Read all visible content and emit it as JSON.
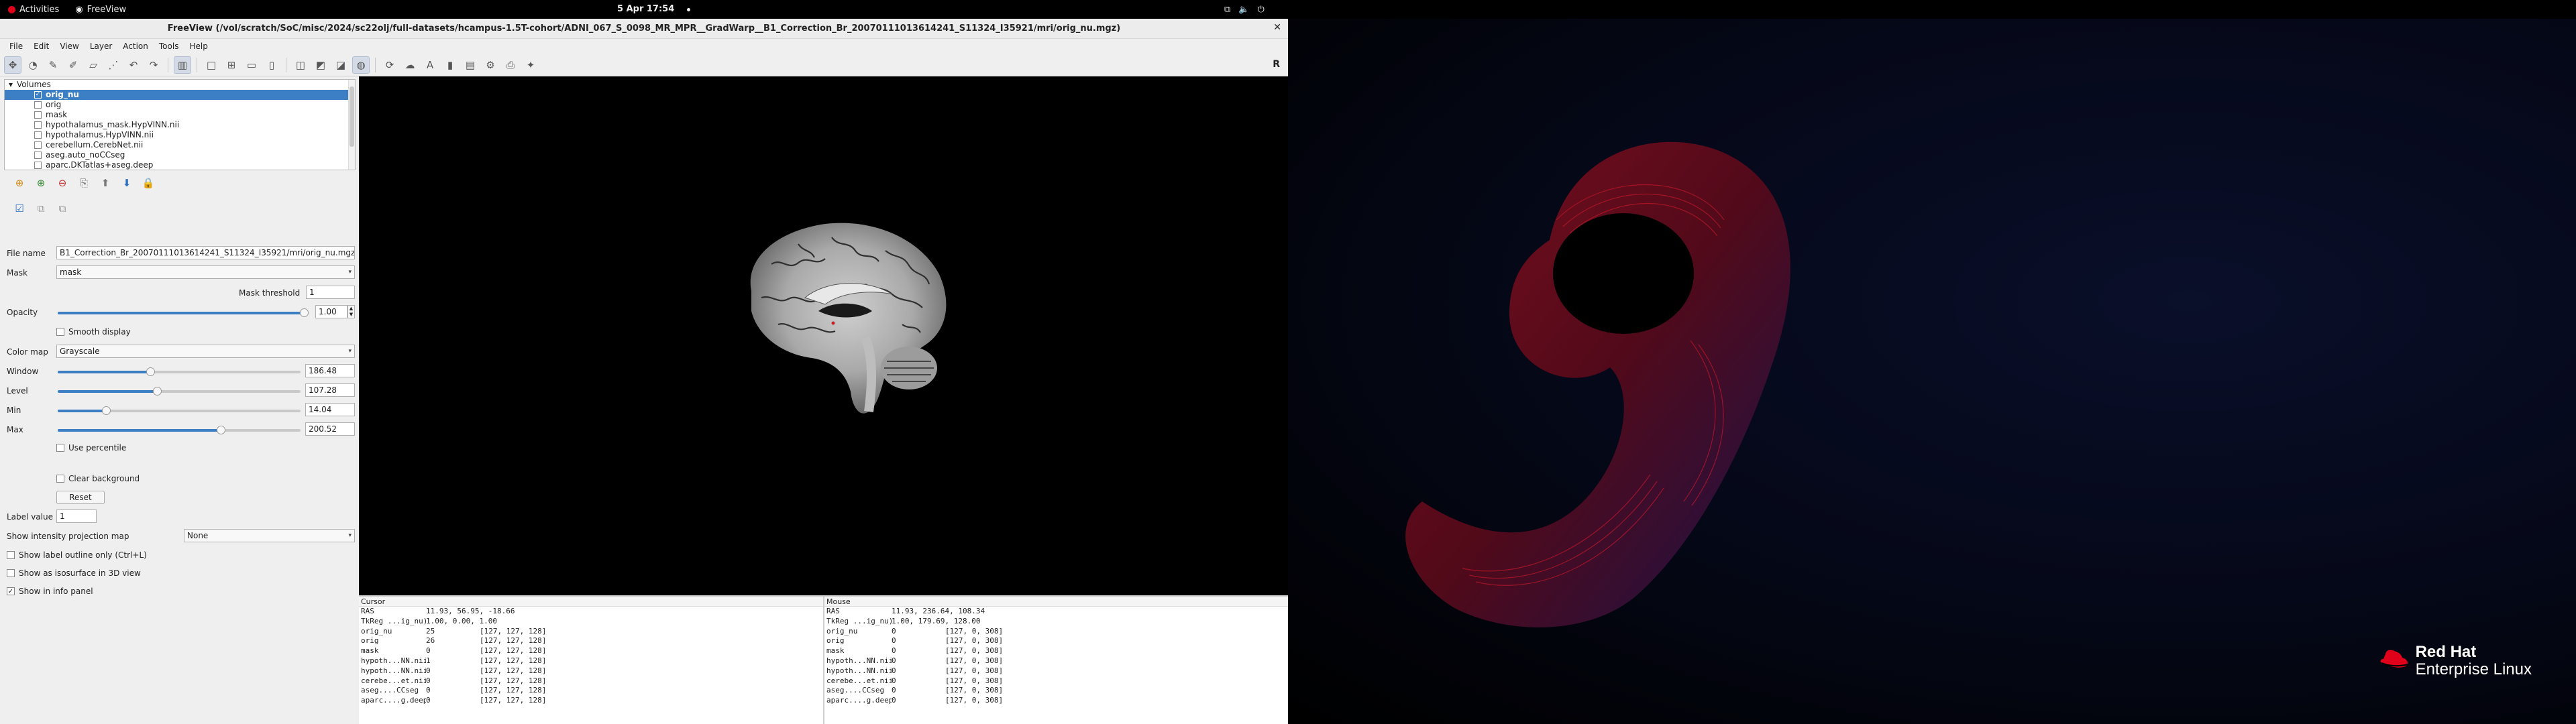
{
  "topbar": {
    "activities": "Activities",
    "app_name": "FreeView",
    "clock": "5 Apr  17:54"
  },
  "window": {
    "title": "FreeView (/vol/scratch/SoC/misc/2024/sc22olj/full-datasets/hcampus-1.5T-cohort/ADNI_067_S_0098_MR_MPR__GradWarp__B1_Correction_Br_20070111013614241_S11324_I35921/mri/orig_nu.mgz)"
  },
  "menu": [
    "File",
    "Edit",
    "View",
    "Layer",
    "Action",
    "Tools",
    "Help"
  ],
  "toolbar": {
    "view_label": "R"
  },
  "layers": {
    "group": "Volumes",
    "items": [
      {
        "name": "orig_nu",
        "checked": true,
        "selected": true
      },
      {
        "name": "orig",
        "checked": false,
        "selected": false
      },
      {
        "name": "mask",
        "checked": false,
        "selected": false
      },
      {
        "name": "hypothalamus_mask.HypVINN.nii",
        "checked": false,
        "selected": false
      },
      {
        "name": "hypothalamus.HypVINN.nii",
        "checked": false,
        "selected": false
      },
      {
        "name": "cerebellum.CerebNet.nii",
        "checked": false,
        "selected": false
      },
      {
        "name": "aseg.auto_noCCseg",
        "checked": false,
        "selected": false
      },
      {
        "name": "aparc.DKTatlas+aseg.deep",
        "checked": false,
        "selected": false
      }
    ]
  },
  "props": {
    "file_name_label": "File name",
    "file_name_value": "B1_Correction_Br_20070111013614241_S11324_I35921/mri/orig_nu.mgz",
    "mask_label": "Mask",
    "mask_value": "mask",
    "mask_threshold_label": "Mask threshold",
    "mask_threshold_value": "1",
    "opacity_label": "Opacity",
    "opacity_value": "1.00",
    "opacity_level": 0.98,
    "smooth_label": "Smooth display",
    "colormap_label": "Color map",
    "colormap_value": "Grayscale",
    "window_label": "Window",
    "window_value": "186.48",
    "window_level": 0.38,
    "level_label": "Level",
    "level_value": "107.28",
    "level_level": 0.41,
    "min_label": "Min",
    "min_value": "14.04",
    "min_level": 0.2,
    "max_label": "Max",
    "max_value": "200.52",
    "max_level": 0.67,
    "use_percentile_label": "Use percentile",
    "clear_bg_label": "Clear background",
    "reset_label": "Reset",
    "label_value_label": "Label value",
    "label_value_value": "1",
    "projection_label": "Show intensity projection map",
    "projection_value": "None",
    "outline_label": "Show label outline only (Ctrl+L)",
    "isosurface_label": "Show as isosurface in 3D view",
    "info_panel_label": "Show in info panel"
  },
  "cursor_panel": {
    "header": "Cursor",
    "rows": [
      {
        "name": "RAS",
        "value": "11.93, 56.95, -18.66",
        "coord": ""
      },
      {
        "name": "TkReg ...ig_nu)",
        "value": "1.00, 0.00, 1.00",
        "coord": ""
      },
      {
        "name": "orig_nu",
        "value": "25",
        "coord": "[127, 127, 128]"
      },
      {
        "name": "orig",
        "value": "26",
        "coord": "[127, 127, 128]"
      },
      {
        "name": "mask",
        "value": "0",
        "coord": "[127, 127, 128]"
      },
      {
        "name": "hypoth...NN.nii",
        "value": "1",
        "coord": "[127, 127, 128]"
      },
      {
        "name": "hypoth...NN.nii",
        "value": "0",
        "coord": "[127, 127, 128]"
      },
      {
        "name": "cerebe...et.nii",
        "value": "0",
        "coord": "[127, 127, 128]"
      },
      {
        "name": "aseg....CCseg",
        "value": "0",
        "coord": "[127, 127, 128]"
      },
      {
        "name": "aparc....g.deep",
        "value": "0",
        "coord": "[127, 127, 128]"
      }
    ]
  },
  "mouse_panel": {
    "header": "Mouse",
    "rows": [
      {
        "name": "RAS",
        "value": "11.93, 236.64, 108.34",
        "coord": ""
      },
      {
        "name": "TkReg ...ig_nu)",
        "value": "1.00, 179.69, 128.00",
        "coord": ""
      },
      {
        "name": "orig_nu",
        "value": "0",
        "coord": "[127, 0, 308]"
      },
      {
        "name": "orig",
        "value": "0",
        "coord": "[127, 0, 308]"
      },
      {
        "name": "mask",
        "value": "0",
        "coord": "[127, 0, 308]"
      },
      {
        "name": "hypoth...NN.nii",
        "value": "0",
        "coord": "[127, 0, 308]"
      },
      {
        "name": "hypoth...NN.nii",
        "value": "0",
        "coord": "[127, 0, 308]"
      },
      {
        "name": "cerebe...et.nii",
        "value": "0",
        "coord": "[127, 0, 308]"
      },
      {
        "name": "aseg....CCseg",
        "value": "0",
        "coord": "[127, 0, 308]"
      },
      {
        "name": "aparc....g.deep",
        "value": "0",
        "coord": "[127, 0, 308]"
      }
    ]
  },
  "desktop": {
    "logo_line1": "Red Hat",
    "logo_line2": "Enterprise Linux"
  },
  "colors": {
    "selection": "#3c7fc4",
    "brand_red": "#e0001a"
  }
}
